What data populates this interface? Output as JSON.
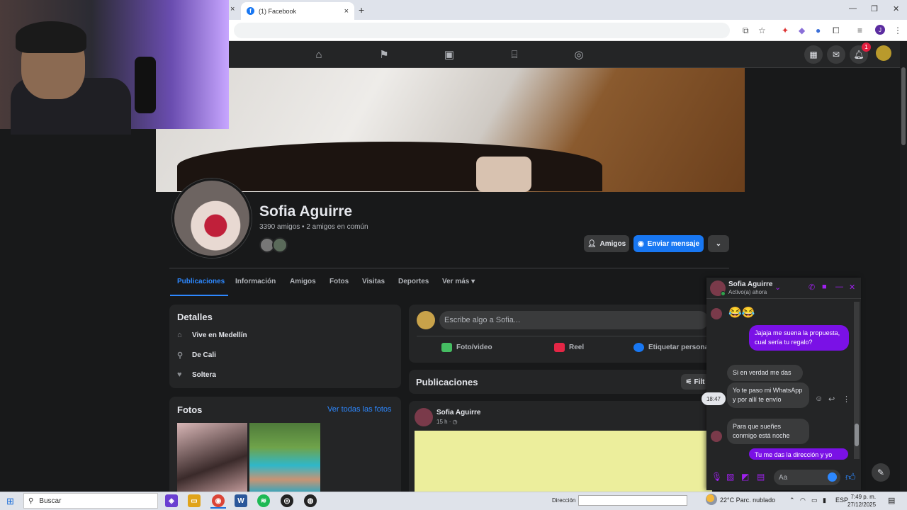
{
  "browser": {
    "tab_title": "(1) Facebook",
    "tab_close": "×",
    "newtab": "+",
    "left_tab_close": "×",
    "win_min": "—",
    "win_max": "❐",
    "win_close": "✕"
  },
  "profile": {
    "name": "Sofia Aguirre",
    "friends_line": "3390 amigos • 2 amigos en común",
    "btn_friends": "Amigos",
    "btn_message": "Enviar mensaje",
    "btn_more": "⌄"
  },
  "tabs": [
    "Publicaciones",
    "Información",
    "Amigos",
    "Fotos",
    "Visitas",
    "Deportes",
    "Ver más ▾"
  ],
  "details": {
    "title": "Detalles",
    "items": [
      "Vive en Medellín",
      "De Cali",
      "Soltera"
    ]
  },
  "photos": {
    "title": "Fotos",
    "link": "Ver todas las fotos"
  },
  "composer": {
    "placeholder": "Escribe algo a Sofia...",
    "photo_video": "Foto/video",
    "reel": "Reel",
    "tag": "Etiquetar persona"
  },
  "posts": {
    "title": "Publicaciones",
    "filter": "Filt",
    "author": "Sofia Aguirre",
    "time": "15 h · ◷"
  },
  "chat": {
    "name": "Sofia Aguirre",
    "status": "Activo(a) ahora",
    "emoji": "😂😂",
    "messages": [
      "Jajaja me suena la propuesta, cual sería tu regalo?",
      "Si en verdad me das",
      "Yo te paso mi WhatsApp y por allí te envío",
      "Para que sueñes conmigo está noche",
      "Tu me das la dirección y yo"
    ],
    "time_chip": "18:47",
    "input_placeholder": "Aa"
  },
  "taskbar": {
    "search": "Buscar",
    "dir_label": "Dirección",
    "weather": "22°C  Parc. nublado",
    "lang": "ESP",
    "time": "7:49 p. m.",
    "date": "27/12/2025"
  },
  "notifications": {
    "count": "1"
  },
  "colors": {
    "accent": "#1877f2",
    "chat_accent": "#7a11e6",
    "bg": "#18191a"
  }
}
